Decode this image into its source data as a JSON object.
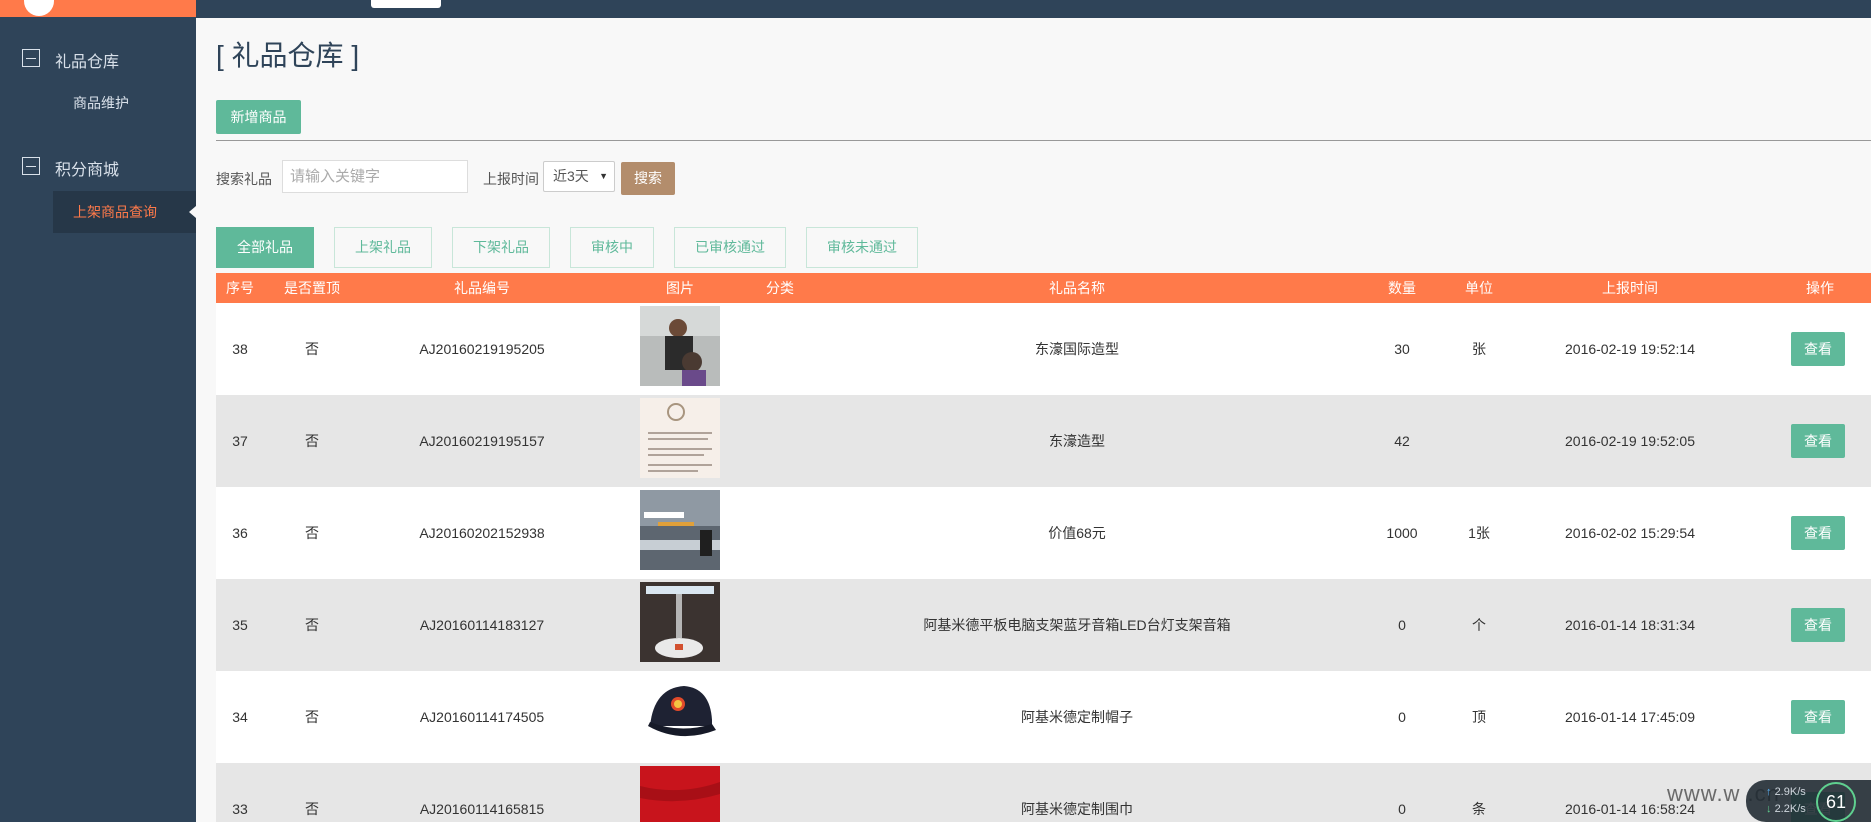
{
  "sidebar": {
    "groups": [
      {
        "label": "礼品仓库",
        "items": [
          {
            "label": "商品维护"
          }
        ]
      },
      {
        "label": "积分商城",
        "items": [
          {
            "label": "上架商品查询"
          }
        ]
      }
    ]
  },
  "main": {
    "title": "[ 礼品仓库 ]",
    "add_button": "新增商品",
    "search": {
      "label": "搜索礼品",
      "placeholder": "请输入关键字",
      "time_label": "上报时间",
      "time_value": "近3天",
      "button": "搜索"
    },
    "tabs": [
      "全部礼品",
      "上架礼品",
      "下架礼品",
      "审核中",
      "已审核通过",
      "审核未通过"
    ],
    "table": {
      "headers": [
        "序号",
        "是否置顶",
        "礼品编号",
        "图片",
        "分类",
        "礼品名称",
        "数量",
        "单位",
        "上报时间",
        "操作"
      ],
      "rows": [
        {
          "no": "38",
          "top": "否",
          "code": "AJ20160219195205",
          "name": "东濠国际造型",
          "qty": "30",
          "unit": "张",
          "time": "2016-02-19 19:52:14",
          "action": "查看"
        },
        {
          "no": "37",
          "top": "否",
          "code": "AJ20160219195157",
          "name": "东濠造型",
          "qty": "42",
          "unit": "",
          "time": "2016-02-19 19:52:05",
          "action": "查看"
        },
        {
          "no": "36",
          "top": "否",
          "code": "AJ20160202152938",
          "name": "价值68元",
          "qty": "1000",
          "unit": "1张",
          "time": "2016-02-02 15:29:54",
          "action": "查看"
        },
        {
          "no": "35",
          "top": "否",
          "code": "AJ20160114183127",
          "name": "阿基米德平板电脑支架蓝牙音箱LED台灯支架音箱",
          "qty": "0",
          "unit": "个",
          "time": "2016-01-14 18:31:34",
          "action": "查看"
        },
        {
          "no": "34",
          "top": "否",
          "code": "AJ20160114174505",
          "name": "阿基米德定制帽子",
          "qty": "0",
          "unit": "顶",
          "time": "2016-01-14 17:45:09",
          "action": "查看"
        },
        {
          "no": "33",
          "top": "否",
          "code": "AJ20160114165815",
          "name": "阿基米德定制围巾",
          "qty": "0",
          "unit": "条",
          "time": "2016-01-14 16:58:24",
          "action": "查看"
        }
      ]
    }
  },
  "overlay": {
    "watermark": "www.w      .cn",
    "net_up": "2.9K/s",
    "net_down": "2.2K/s",
    "percent": "61"
  },
  "colors": {
    "brand": "#ff7a4a",
    "accent": "#5fb99a",
    "sidebar": "#2f4459",
    "search_button": "#b38d6c"
  }
}
